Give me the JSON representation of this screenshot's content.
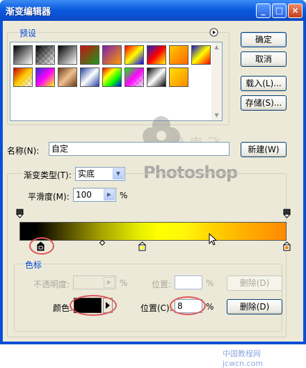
{
  "window": {
    "title": "渐变编辑器",
    "controls": {
      "minimize": "_",
      "maximize": "□",
      "close": "×"
    }
  },
  "presets": {
    "legend": "预设",
    "menu_icon": "circle-arrow-icon",
    "swatches": [
      {
        "colors": [
          "#000000",
          "#ffffff"
        ]
      },
      {
        "colors": [
          "#000000",
          "transparent"
        ]
      },
      {
        "colors": [
          "#000000",
          "#ffffff"
        ]
      },
      {
        "colors": [
          "#cc1010",
          "#1a9a1a"
        ]
      },
      {
        "colors": [
          "#7a1fb0",
          "#ff9a00"
        ]
      },
      {
        "colors": [
          "#ff0000",
          "#ffff00",
          "#0000ff"
        ]
      },
      {
        "colors": [
          "#2020c0",
          "#ff0000",
          "#ffff00"
        ]
      },
      {
        "colors": [
          "#ffcc00",
          "#ff6600"
        ]
      },
      {
        "colors": [
          "#1010c0",
          "#ffff00",
          "#ff0000"
        ]
      },
      {
        "colors": [
          "#cc0000",
          "#ffcc00",
          "transparent"
        ]
      },
      {
        "colors": [
          "#3030d0",
          "#ff00ff",
          "#ffff00"
        ]
      },
      {
        "colors": [
          "#6a3a1a",
          "#f0c090",
          "#6a3a1a"
        ]
      },
      {
        "colors": [
          "#2040a0",
          "#ffffff",
          "#2040a0"
        ]
      },
      {
        "colors": [
          "#ff0000",
          "#ffff00",
          "#00ff00",
          "#0000ff"
        ]
      },
      {
        "colors": [
          "#00ff00",
          "#ff00ff",
          "transparent"
        ]
      },
      {
        "colors": [
          "#000000",
          "#ffffff",
          "#000000"
        ]
      },
      {
        "colors": [
          "#ffe000",
          "#ff8800"
        ]
      }
    ]
  },
  "buttons": {
    "ok": "确定",
    "cancel": "取消",
    "load": "载入(L)...",
    "save": "存储(S)...",
    "new": "新建(W)",
    "delete_opacity": "删除(D)",
    "delete_color": "删除(D)"
  },
  "name_row": {
    "label": "名称(N):",
    "value": "自定"
  },
  "gradient_type": {
    "label": "渐变类型(T):",
    "value": "实底"
  },
  "smoothness": {
    "label": "平滑度(M):",
    "value": "100",
    "unit": "%"
  },
  "stops": {
    "legend": "色标",
    "opacity_label": "不透明度:",
    "opacity_unit": "%",
    "opacity_location_label": "位置:",
    "opacity_location_unit": "%",
    "color_label": "颜色:",
    "location_label": "位置(C):",
    "location_value": "8",
    "location_unit": "%",
    "selected_color": "#000000"
  },
  "gradient": {
    "color_stops": [
      {
        "position": 8,
        "color": "#000000",
        "selected": true
      },
      {
        "position": 46,
        "color": "#ffff00"
      },
      {
        "position": 100,
        "color": "#ff8a00"
      }
    ],
    "opacity_stops": [
      {
        "position": 0
      },
      {
        "position": 100
      }
    ],
    "midpoint": 31
  },
  "watermark": {
    "text": "Photoshop",
    "cn": [
      "缘",
      "南",
      "飞"
    ],
    "footer": "中国教程网 jcwcn.com"
  },
  "colors": {
    "accent": "#0046d5",
    "highlight_ellipse": "#e0555b"
  }
}
